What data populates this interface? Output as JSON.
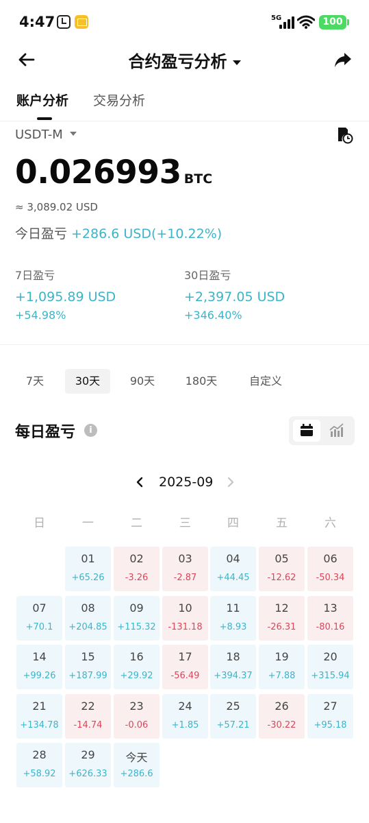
{
  "status_bar": {
    "time": "4:47",
    "network": "5G",
    "battery": "100"
  },
  "header": {
    "title": "合约盈亏分析"
  },
  "tabs": [
    {
      "label": "账户分析"
    },
    {
      "label": "交易分析"
    }
  ],
  "account": {
    "selector": "USDT-M",
    "balance": "0.026993",
    "balance_unit": "BTC",
    "usd_approx": "≈ 3,089.02 USD",
    "today_label": "今日盈亏",
    "today_value": "+286.6 USD(+10.22%)"
  },
  "pnl_7d": {
    "label": "7日盈亏",
    "amount": "+1,095.89 USD",
    "percent": "+54.98%"
  },
  "pnl_30d": {
    "label": "30日盈亏",
    "amount": "+2,397.05 USD",
    "percent": "+346.40%"
  },
  "ranges": [
    "7天",
    "30天",
    "90天",
    "180天",
    "自定义"
  ],
  "daily": {
    "title": "每日盈亏",
    "month": "2025-09",
    "weekdays": [
      "日",
      "一",
      "二",
      "三",
      "四",
      "五",
      "六"
    ],
    "days": [
      {
        "label": "01",
        "value": "+65.26"
      },
      {
        "label": "02",
        "value": "-3.26"
      },
      {
        "label": "03",
        "value": "-2.87"
      },
      {
        "label": "04",
        "value": "+44.45"
      },
      {
        "label": "05",
        "value": "-12.62"
      },
      {
        "label": "06",
        "value": "-50.34"
      },
      {
        "label": "07",
        "value": "+70.1"
      },
      {
        "label": "08",
        "value": "+204.85"
      },
      {
        "label": "09",
        "value": "+115.32"
      },
      {
        "label": "10",
        "value": "-131.18"
      },
      {
        "label": "11",
        "value": "+8.93"
      },
      {
        "label": "12",
        "value": "-26.31"
      },
      {
        "label": "13",
        "value": "-80.16"
      },
      {
        "label": "14",
        "value": "+99.26"
      },
      {
        "label": "15",
        "value": "+187.99"
      },
      {
        "label": "16",
        "value": "+29.92"
      },
      {
        "label": "17",
        "value": "-56.49"
      },
      {
        "label": "18",
        "value": "+394.37"
      },
      {
        "label": "19",
        "value": "+7.88"
      },
      {
        "label": "20",
        "value": "+315.94"
      },
      {
        "label": "21",
        "value": "+134.78"
      },
      {
        "label": "22",
        "value": "-14.74"
      },
      {
        "label": "23",
        "value": "-0.06"
      },
      {
        "label": "24",
        "value": "+1.85"
      },
      {
        "label": "25",
        "value": "+57.21"
      },
      {
        "label": "26",
        "value": "-30.22"
      },
      {
        "label": "27",
        "value": "+95.18"
      },
      {
        "label": "28",
        "value": "+58.92"
      },
      {
        "label": "29",
        "value": "+626.33"
      },
      {
        "label": "今天",
        "value": "+286.6"
      }
    ]
  },
  "colors": {
    "profit": "#3cb4c8",
    "loss": "#d9475a",
    "profit_bg": "#eef8fc",
    "loss_bg": "#fbeeef"
  }
}
